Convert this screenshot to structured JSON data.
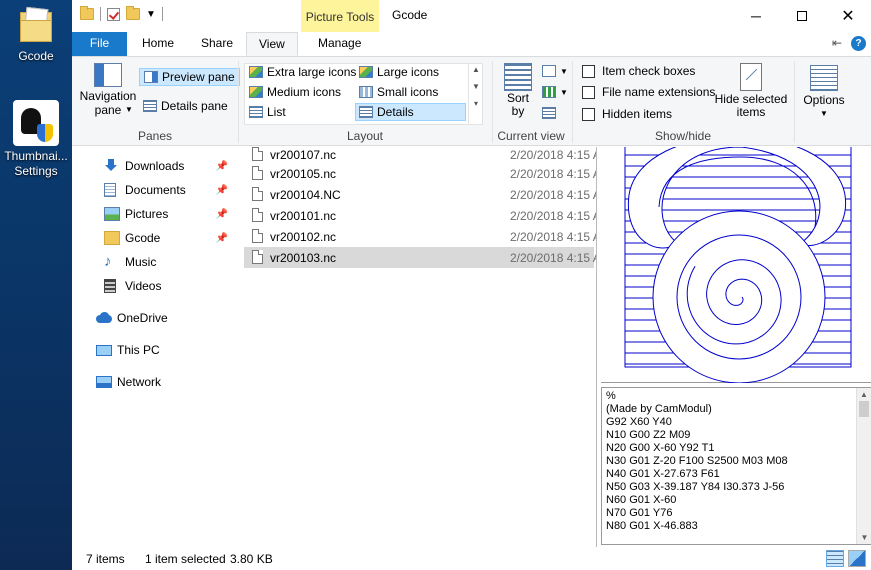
{
  "desktop": {
    "icons": [
      {
        "label": "Gcode"
      },
      {
        "label": "Thumbnai...\nSettings"
      }
    ]
  },
  "window": {
    "title": "Gcode",
    "contextual_group": "Picture Tools",
    "tabs": [
      "File",
      "Home",
      "Share",
      "View",
      "Manage"
    ],
    "active_tab": "View"
  },
  "ribbon": {
    "panes": {
      "label": "Panes",
      "navigation_pane": "Navigation\npane",
      "preview_pane": "Preview pane",
      "details_pane": "Details pane"
    },
    "layout": {
      "label": "Layout",
      "options": [
        "Extra large icons",
        "Large icons",
        "Medium icons",
        "Small icons",
        "List",
        "Details"
      ],
      "selected": "Details"
    },
    "current_view": {
      "label": "Current view",
      "sort_by": "Sort\nby"
    },
    "show_hide": {
      "label": "Show/hide",
      "item_check_boxes": "Item check boxes",
      "file_name_extensions": "File name extensions",
      "hidden_items": "Hidden items",
      "hide_selected": "Hide selected\nitems"
    },
    "options": "Options"
  },
  "nav": {
    "items": [
      {
        "label": "Downloads",
        "pinned": true
      },
      {
        "label": "Documents",
        "pinned": true
      },
      {
        "label": "Pictures",
        "pinned": true
      },
      {
        "label": "Gcode",
        "pinned": true
      },
      {
        "label": "Music",
        "pinned": false
      },
      {
        "label": "Videos",
        "pinned": false
      },
      {
        "label": "OneDrive",
        "pinned": false
      },
      {
        "label": "This PC",
        "pinned": false
      },
      {
        "label": "Network",
        "pinned": false
      }
    ]
  },
  "files": [
    {
      "name": "vr200107.nc",
      "date": "2/20/2018 4:15 A"
    },
    {
      "name": "vr200105.nc",
      "date": "2/20/2018 4:15 A"
    },
    {
      "name": "vr200104.NC",
      "date": "2/20/2018 4:15 A"
    },
    {
      "name": "vr200101.nc",
      "date": "2/20/2018 4:15 A"
    },
    {
      "name": "vr200102.nc",
      "date": "2/20/2018 4:15 A"
    },
    {
      "name": "vr200103.nc",
      "date": "2/20/2018 4:15 A",
      "selected": true
    }
  ],
  "preview_text": [
    "%",
    "(Made by CamModul)",
    "G92 X60 Y40",
    "N10 G00 Z2 M09",
    "N20 G00 X-60 Y92 T1",
    "N30 G01 Z-20 F100 S2500 M03 M08",
    "N40 G01 X-27.673 F61",
    "N50 G03 X-39.187 Y84 I30.373 J-56",
    "N60 G01 X-60",
    "N70 G01 Y76",
    "N80 G01 X-46.883"
  ],
  "status": {
    "items": "7 items",
    "selection": "1 item selected",
    "size": "3.80 KB"
  },
  "colors": {
    "accent": "#1979ca",
    "picture_tools": "#fdf49c",
    "drawing": "#0000cc"
  }
}
